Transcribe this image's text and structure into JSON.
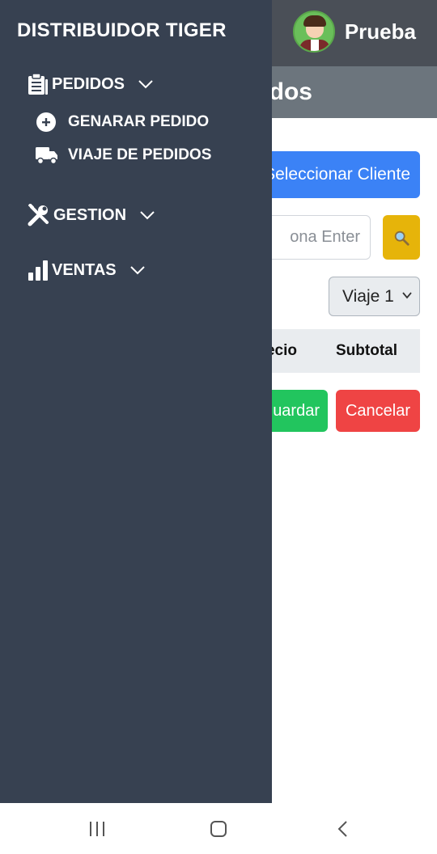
{
  "header": {
    "user_name": "Prueba",
    "page_title_partial": "dos"
  },
  "main": {
    "select_client_label": "Seleccionar Cliente",
    "search_placeholder": "ona Enter",
    "trip_select_value": "Viaje 1",
    "table_headers": [
      "ecio",
      "Subtotal"
    ],
    "save_label": "uardar",
    "cancel_label": "Cancelar"
  },
  "drawer": {
    "brand": "DISTRIBUIDOR TIGER",
    "menus": [
      {
        "label": "PEDIDOS",
        "icon": "clipboard-icon",
        "items": [
          {
            "label": "GENARAR PEDIDO",
            "icon": "plus-circle-icon"
          },
          {
            "label": "VIAJE DE PEDIDOS",
            "icon": "truck-icon"
          }
        ]
      },
      {
        "label": "GESTION",
        "icon": "tools-icon",
        "items": []
      },
      {
        "label": "VENTAS",
        "icon": "bar-chart-icon",
        "items": []
      }
    ]
  },
  "colors": {
    "drawer_bg": "#374151",
    "topbar_bg": "#4a4f57",
    "subbar_bg": "#6c757d",
    "primary": "#3b82f6",
    "warning": "#e6b40a",
    "success": "#22c55e",
    "danger": "#ef4444"
  }
}
